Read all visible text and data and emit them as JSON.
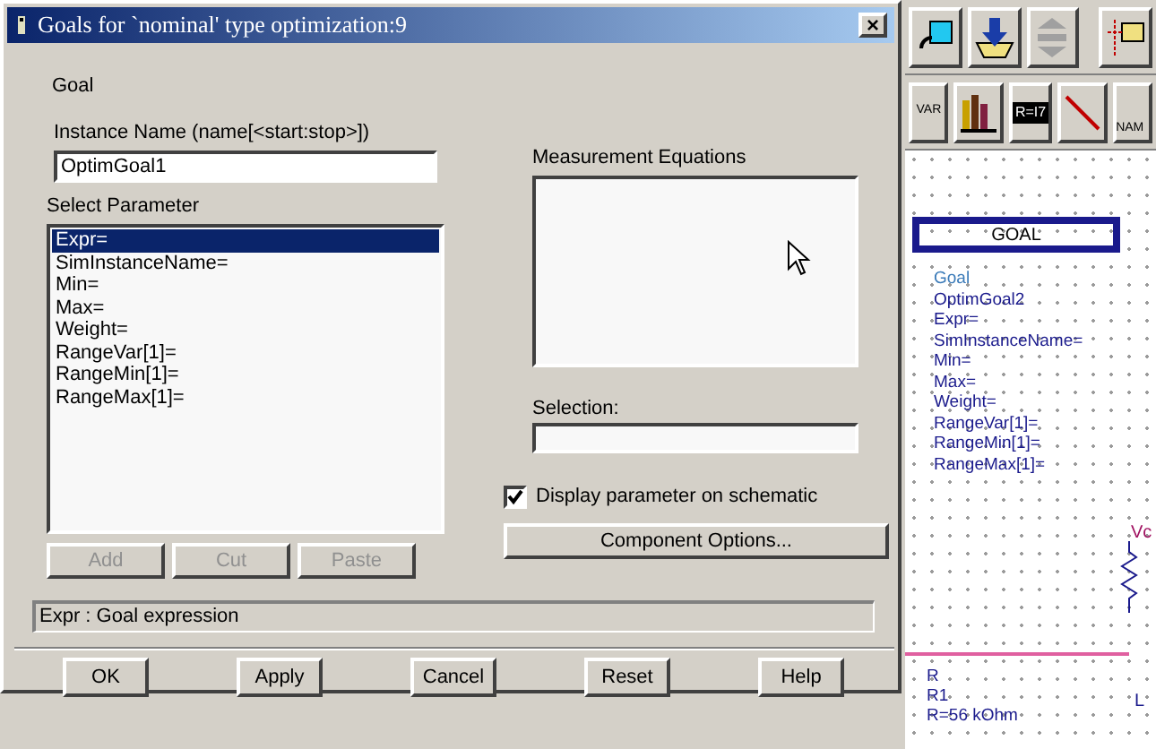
{
  "dialog": {
    "title": "Goals for `nominal' type optimization:9",
    "close": "×",
    "heading": "Goal",
    "instance_name": {
      "label": "Instance Name  (name[<start:stop>])",
      "value": "OptimGoal1"
    },
    "select_parameter": {
      "label": "Select Parameter",
      "items": [
        {
          "label": "Expr=",
          "selected": true
        },
        {
          "label": "SimInstanceName=",
          "selected": false
        },
        {
          "label": "Min=",
          "selected": false
        },
        {
          "label": "Max=",
          "selected": false
        },
        {
          "label": "Weight=",
          "selected": false
        },
        {
          "label": "RangeVar[1]=",
          "selected": false
        },
        {
          "label": "RangeMin[1]=",
          "selected": false
        },
        {
          "label": "RangeMax[1]=",
          "selected": false
        }
      ]
    },
    "list_buttons": [
      {
        "label": "Add",
        "disabled": true
      },
      {
        "label": "Cut",
        "disabled": true
      },
      {
        "label": "Paste",
        "disabled": true
      }
    ],
    "measurement_equations": {
      "label": "Measurement Equations"
    },
    "selection": {
      "label": "Selection:"
    },
    "display_on_schematic": {
      "label": "Display parameter on schematic",
      "checked": true
    },
    "component_options": "Component Options...",
    "status": "Expr : Goal expression",
    "buttons": [
      "OK",
      "Apply",
      "Cancel",
      "Reset",
      "Help"
    ]
  },
  "palette": {
    "var_label": "VAR",
    "eqn_label": "R=I7",
    "name_label": "NAM"
  },
  "schematic": {
    "goal_block": "GOAL",
    "goal_lines": [
      "Goal",
      "OptimGoal2",
      "Expr=",
      "SimInstanceName=",
      "Min=",
      "Max=",
      "Weight=",
      "RangeVar[1]=",
      "RangeMin[1]=",
      "RangeMax[1]="
    ],
    "resistor_left": [
      "R",
      "R1",
      "R=56 kOhm"
    ],
    "resistor_right_label": "Vc",
    "inductor_label": "L"
  }
}
